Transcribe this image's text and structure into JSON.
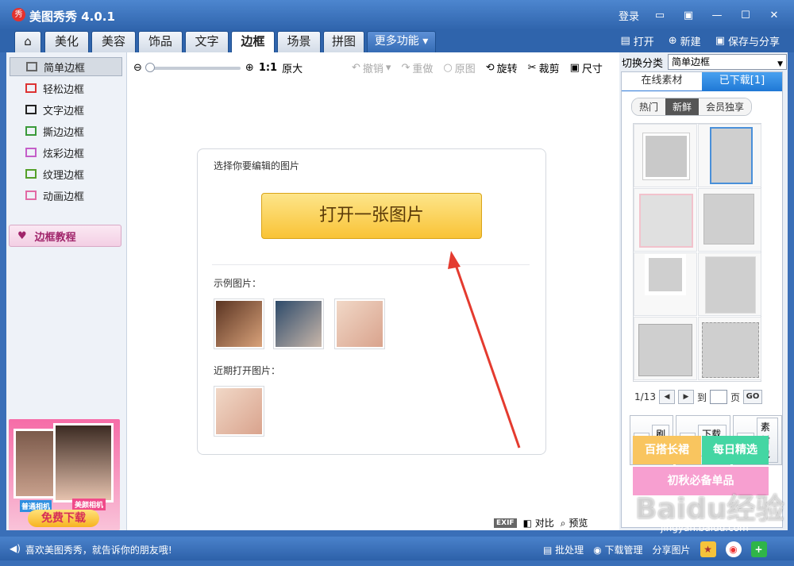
{
  "app": {
    "logo_text": "秀",
    "title": "美图秀秀 4.0.1",
    "login": "登录"
  },
  "tabs": [
    "",
    "美化",
    "美容",
    "饰品",
    "文字",
    "边框",
    "场景",
    "拼图",
    "更多功能"
  ],
  "header_actions": {
    "open": "打开",
    "new": "新建",
    "save": "保存与分享"
  },
  "left": {
    "items": [
      "简单边框",
      "轻松边框",
      "文字边框",
      "撕边边框",
      "炫彩边框",
      "纹理边框",
      "动画边框"
    ],
    "tutorial": "边框教程",
    "ad_label1": "普通相机",
    "ad_label2": "美颜相机",
    "ad_button": "免费下载"
  },
  "toolbar": {
    "zoom_level": "1:1",
    "original_size": "原大",
    "undo": "撤销",
    "redo": "重做",
    "original": "原图",
    "rotate": "旋转",
    "crop": "裁剪",
    "size": "尺寸"
  },
  "card": {
    "choose_label": "选择你要编辑的图片",
    "open_button": "打开一张图片",
    "examples_label": "示例图片：",
    "recent_label": "近期打开图片："
  },
  "bottom_tools": {
    "exif": "EXIF",
    "compare": "对比",
    "preview": "预览"
  },
  "right": {
    "switch_label": "切换分类",
    "category": "简单边框",
    "tab_online": "在线素材",
    "tab_downloaded": "已下载[1]",
    "filters": [
      "热门",
      "新鲜",
      "会员独享"
    ],
    "page": "1/13",
    "goto": "到",
    "page_unit": "页",
    "go": "GO",
    "refresh": "刷新",
    "download_page": "下载本页",
    "material_pack": "素材包",
    "promo1": "百搭长裙",
    "promo2": "每日精选",
    "promo3": "初秋必备单品"
  },
  "status": {
    "message": "喜欢美图秀秀，就告诉你的朋友哦!",
    "batch": "批处理",
    "download_manage": "下载管理",
    "share": "分享图片"
  },
  "watermark": {
    "text": "Baidu经验",
    "url": "jingyan.baidu.com"
  }
}
